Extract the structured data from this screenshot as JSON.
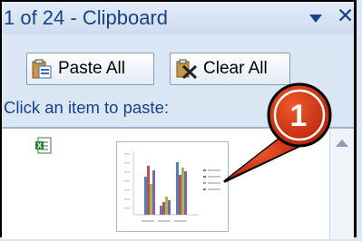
{
  "pane": {
    "title": "1 of 24 - Clipboard"
  },
  "toolbar": {
    "paste_all_label": "Paste All",
    "clear_all_label": "Clear All"
  },
  "instruction": "Click an item to paste:",
  "clipboard_items": [
    {
      "source_icon": "excel-icon",
      "thumbnail": "bar-chart-thumbnail"
    }
  ],
  "callout": {
    "number": "1",
    "color": "#c7290a"
  },
  "colors": {
    "pane_bg": "#dbe6f4",
    "title_text": "#15428b",
    "list_bg": "#ffffff"
  }
}
